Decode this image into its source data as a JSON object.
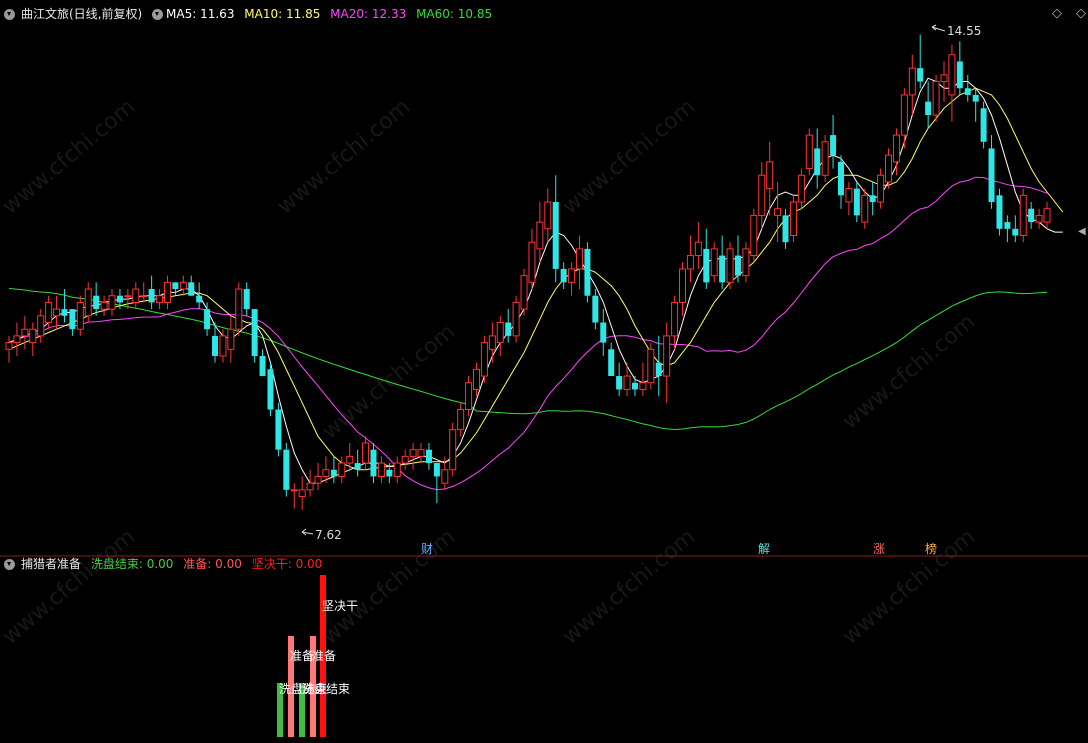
{
  "main": {
    "title": "曲江文旅(日线,前复权)",
    "ma_legend": [
      {
        "label": "MA5:",
        "value": "11.63",
        "color": "#ffffff"
      },
      {
        "label": "MA10:",
        "value": "11.85",
        "color": "#ffff66"
      },
      {
        "label": "MA20:",
        "value": "12.33",
        "color": "#ff44ff"
      },
      {
        "label": "MA60:",
        "value": "10.85",
        "color": "#33dd33"
      }
    ],
    "high_label": "14.55",
    "low_label": "7.62",
    "event_markers": [
      {
        "label": "财",
        "color": "#66aaff"
      },
      {
        "label": "解",
        "color": "#66dddd"
      },
      {
        "label": "涨",
        "color": "#ff6666"
      },
      {
        "label": "榜",
        "color": "#ffaa44"
      }
    ],
    "watermark": "www.cfchi.com"
  },
  "sub": {
    "title": "捕猎者准备",
    "legend": [
      {
        "label": "洗盘结束:",
        "value": "0.00",
        "color": "#44cc44"
      },
      {
        "label": "准备:",
        "value": "0.00",
        "color": "#ff5555"
      },
      {
        "label": "坚决干:",
        "value": "0.00",
        "color": "#ff2222"
      }
    ],
    "bar_labels": {
      "wash": "洗盘结束",
      "ready": "准备",
      "decisive": "坚决干"
    }
  },
  "colors": {
    "up": "#ff3333",
    "down": "#2ee6e6",
    "bg": "#000000",
    "divider": "#8a1a1a"
  },
  "chart_data": {
    "type": "candlestick",
    "ylim": [
      7.3,
      14.8
    ],
    "candles": [
      [
        10.0,
        10.2,
        9.8,
        10.1
      ],
      [
        10.1,
        10.4,
        9.9,
        10.2
      ],
      [
        10.2,
        10.5,
        10.0,
        10.3
      ],
      [
        10.1,
        10.4,
        9.9,
        10.3
      ],
      [
        10.2,
        10.6,
        10.1,
        10.5
      ],
      [
        10.4,
        10.8,
        10.3,
        10.7
      ],
      [
        10.5,
        10.8,
        10.3,
        10.6
      ],
      [
        10.6,
        10.9,
        10.4,
        10.5
      ],
      [
        10.6,
        10.6,
        10.2,
        10.3
      ],
      [
        10.3,
        10.8,
        10.2,
        10.7
      ],
      [
        10.5,
        11.0,
        10.4,
        10.9
      ],
      [
        10.8,
        11.0,
        10.5,
        10.6
      ],
      [
        10.6,
        10.8,
        10.5,
        10.7
      ],
      [
        10.6,
        10.9,
        10.5,
        10.8
      ],
      [
        10.8,
        10.9,
        10.6,
        10.7
      ],
      [
        10.8,
        10.9,
        10.6,
        10.8
      ],
      [
        10.7,
        11.0,
        10.6,
        10.9
      ],
      [
        10.8,
        11.0,
        10.7,
        10.8
      ],
      [
        10.9,
        11.1,
        10.6,
        10.7
      ],
      [
        10.7,
        10.9,
        10.6,
        10.8
      ],
      [
        10.7,
        11.1,
        10.6,
        11.0
      ],
      [
        11.0,
        11.0,
        10.8,
        10.9
      ],
      [
        10.9,
        11.1,
        10.8,
        11.0
      ],
      [
        11.0,
        11.1,
        10.8,
        10.8
      ],
      [
        10.8,
        11.0,
        10.6,
        10.7
      ],
      [
        10.6,
        10.7,
        10.2,
        10.3
      ],
      [
        10.2,
        10.4,
        9.8,
        9.9
      ],
      [
        9.9,
        10.3,
        9.8,
        10.2
      ],
      [
        10.0,
        10.5,
        9.8,
        10.3
      ],
      [
        10.3,
        11.0,
        10.2,
        10.9
      ],
      [
        10.9,
        11.0,
        10.5,
        10.6
      ],
      [
        10.6,
        10.6,
        9.8,
        9.9
      ],
      [
        9.9,
        10.0,
        9.6,
        9.6
      ],
      [
        9.7,
        9.8,
        9.0,
        9.1
      ],
      [
        9.1,
        9.2,
        8.4,
        8.5
      ],
      [
        8.5,
        8.6,
        7.8,
        7.9
      ],
      [
        7.9,
        8.0,
        7.62,
        7.9
      ],
      [
        7.8,
        8.1,
        7.6,
        7.9
      ],
      [
        7.9,
        8.2,
        7.8,
        8.0
      ],
      [
        8.0,
        8.3,
        7.9,
        8.1
      ],
      [
        8.1,
        8.4,
        8.0,
        8.2
      ],
      [
        8.2,
        8.4,
        8.0,
        8.1
      ],
      [
        8.1,
        8.4,
        8.0,
        8.3
      ],
      [
        8.3,
        8.6,
        8.2,
        8.4
      ],
      [
        8.3,
        8.5,
        8.1,
        8.2
      ],
      [
        8.3,
        8.7,
        8.2,
        8.6
      ],
      [
        8.5,
        8.6,
        8.0,
        8.1
      ],
      [
        8.1,
        8.4,
        8.0,
        8.3
      ],
      [
        8.2,
        8.3,
        8.0,
        8.1
      ],
      [
        8.1,
        8.4,
        8.0,
        8.3
      ],
      [
        8.3,
        8.5,
        8.2,
        8.4
      ],
      [
        8.4,
        8.6,
        8.2,
        8.5
      ],
      [
        8.4,
        8.6,
        8.3,
        8.5
      ],
      [
        8.5,
        8.6,
        8.2,
        8.3
      ],
      [
        8.3,
        8.3,
        7.7,
        8.1
      ],
      [
        8.0,
        8.4,
        7.9,
        8.2
      ],
      [
        8.2,
        8.9,
        8.1,
        8.8
      ],
      [
        8.8,
        9.2,
        8.7,
        9.1
      ],
      [
        9.1,
        9.6,
        9.0,
        9.5
      ],
      [
        9.4,
        9.8,
        9.3,
        9.7
      ],
      [
        9.6,
        10.2,
        9.5,
        10.1
      ],
      [
        10.0,
        10.4,
        9.8,
        10.2
      ],
      [
        10.1,
        10.5,
        9.9,
        10.4
      ],
      [
        10.4,
        10.6,
        10.1,
        10.2
      ],
      [
        10.2,
        10.8,
        10.1,
        10.7
      ],
      [
        10.6,
        11.2,
        10.5,
        11.1
      ],
      [
        11.0,
        11.8,
        10.9,
        11.6
      ],
      [
        11.5,
        12.2,
        11.3,
        11.9
      ],
      [
        11.8,
        12.4,
        11.6,
        12.2
      ],
      [
        12.2,
        12.6,
        11.0,
        11.2
      ],
      [
        11.2,
        11.3,
        10.9,
        11.0
      ],
      [
        11.0,
        11.3,
        10.8,
        11.2
      ],
      [
        11.2,
        11.7,
        10.9,
        11.5
      ],
      [
        11.5,
        11.6,
        10.7,
        10.8
      ],
      [
        10.8,
        10.9,
        10.3,
        10.4
      ],
      [
        10.4,
        10.6,
        9.9,
        10.1
      ],
      [
        10.0,
        10.1,
        9.6,
        9.6
      ],
      [
        9.6,
        9.8,
        9.3,
        9.4
      ],
      [
        9.4,
        9.8,
        9.3,
        9.6
      ],
      [
        9.5,
        9.6,
        9.3,
        9.4
      ],
      [
        9.4,
        9.8,
        9.3,
        9.5
      ],
      [
        9.5,
        10.1,
        9.4,
        10.0
      ],
      [
        9.8,
        10.2,
        9.3,
        9.6
      ],
      [
        9.6,
        10.4,
        9.2,
        10.2
      ],
      [
        10.2,
        10.8,
        10.0,
        10.7
      ],
      [
        10.7,
        11.3,
        10.5,
        11.2
      ],
      [
        11.2,
        11.7,
        11.0,
        11.4
      ],
      [
        11.4,
        11.9,
        11.2,
        11.6
      ],
      [
        11.5,
        11.8,
        10.9,
        11.0
      ],
      [
        11.1,
        11.6,
        11.0,
        11.5
      ],
      [
        11.4,
        11.7,
        10.9,
        11.0
      ],
      [
        11.0,
        11.6,
        10.9,
        11.5
      ],
      [
        11.4,
        11.7,
        11.0,
        11.1
      ],
      [
        11.1,
        11.6,
        11.0,
        11.5
      ],
      [
        11.4,
        12.1,
        11.3,
        12.0
      ],
      [
        12.0,
        12.8,
        11.8,
        12.6
      ],
      [
        12.4,
        13.1,
        12.0,
        12.8
      ],
      [
        12.0,
        12.5,
        11.6,
        12.1
      ],
      [
        12.0,
        12.1,
        11.5,
        11.6
      ],
      [
        11.7,
        12.3,
        11.6,
        12.2
      ],
      [
        12.2,
        12.7,
        12.1,
        12.6
      ],
      [
        12.7,
        13.3,
        12.6,
        13.2
      ],
      [
        13.0,
        13.3,
        12.4,
        12.6
      ],
      [
        12.6,
        13.2,
        12.5,
        13.1
      ],
      [
        13.2,
        13.5,
        12.7,
        12.9
      ],
      [
        12.8,
        12.9,
        12.1,
        12.3
      ],
      [
        12.2,
        12.5,
        12.0,
        12.4
      ],
      [
        12.4,
        12.5,
        11.9,
        12.0
      ],
      [
        11.9,
        12.4,
        11.8,
        12.3
      ],
      [
        12.3,
        12.5,
        12.0,
        12.2
      ],
      [
        12.2,
        12.7,
        12.1,
        12.6
      ],
      [
        12.5,
        13.0,
        12.4,
        12.9
      ],
      [
        12.8,
        13.3,
        12.6,
        13.2
      ],
      [
        13.2,
        13.9,
        13.0,
        13.8
      ],
      [
        13.8,
        14.4,
        13.5,
        14.2
      ],
      [
        14.2,
        14.7,
        13.9,
        14.0
      ],
      [
        13.7,
        14.0,
        13.3,
        13.5
      ],
      [
        13.5,
        14.1,
        13.4,
        14.0
      ],
      [
        14.0,
        14.3,
        13.7,
        14.1
      ],
      [
        13.8,
        14.55,
        13.4,
        14.4
      ],
      [
        14.3,
        14.6,
        13.8,
        13.9
      ],
      [
        13.9,
        14.1,
        13.7,
        13.8
      ],
      [
        13.8,
        13.9,
        13.4,
        13.7
      ],
      [
        13.6,
        13.7,
        13.0,
        13.1
      ],
      [
        13.0,
        13.2,
        12.1,
        12.2
      ],
      [
        12.3,
        12.4,
        11.7,
        11.8
      ],
      [
        11.9,
        12.0,
        11.6,
        11.8
      ],
      [
        11.8,
        12.0,
        11.6,
        11.7
      ],
      [
        11.7,
        12.4,
        11.6,
        12.3
      ],
      [
        12.1,
        12.2,
        11.8,
        11.9
      ],
      [
        11.9,
        12.1,
        11.8,
        12.0
      ],
      [
        11.9,
        12.2,
        11.8,
        12.1
      ]
    ],
    "ma5": [
      10.1,
      10.15,
      10.2,
      10.25,
      10.3,
      10.4,
      10.5,
      10.55,
      10.55,
      10.6,
      10.65,
      10.65,
      10.7,
      10.72,
      10.75,
      10.75,
      10.78,
      10.8,
      10.8,
      10.8,
      10.85,
      10.85,
      10.9,
      10.9,
      10.8,
      10.6,
      10.35,
      10.2,
      10.15,
      10.25,
      10.35,
      10.4,
      10.2,
      9.8,
      9.3,
      8.85,
      8.45,
      8.2,
      8.0,
      8.0,
      8.05,
      8.1,
      8.15,
      8.2,
      8.25,
      8.3,
      8.3,
      8.3,
      8.25,
      8.25,
      8.3,
      8.35,
      8.4,
      8.4,
      8.35,
      8.3,
      8.4,
      8.6,
      8.9,
      9.25,
      9.6,
      9.9,
      10.1,
      10.25,
      10.4,
      10.6,
      10.9,
      11.3,
      11.6,
      11.75,
      11.7,
      11.55,
      11.35,
      11.15,
      10.95,
      10.7,
      10.35,
      10.0,
      9.75,
      9.55,
      9.5,
      9.55,
      9.6,
      9.75,
      10.0,
      10.4,
      10.8,
      11.1,
      11.3,
      11.35,
      11.35,
      11.35,
      11.35,
      11.4,
      11.5,
      11.8,
      12.1,
      12.3,
      12.35,
      12.3,
      12.3,
      12.5,
      12.7,
      12.85,
      12.9,
      12.85,
      12.7,
      12.5,
      12.35,
      12.25,
      12.3,
      12.5,
      12.75,
      13.1,
      13.5,
      13.85,
      14.05,
      14.0,
      13.9,
      13.9,
      14.0,
      14.0,
      13.9,
      13.75,
      13.5,
      13.15,
      12.75,
      12.35,
      12.05,
      11.95,
      11.9,
      11.8,
      11.75,
      11.75
    ],
    "ma10": [
      10.0,
      10.05,
      10.1,
      10.15,
      10.2,
      10.25,
      10.3,
      10.35,
      10.4,
      10.45,
      10.5,
      10.55,
      10.58,
      10.62,
      10.65,
      10.68,
      10.7,
      10.72,
      10.74,
      10.76,
      10.78,
      10.8,
      10.82,
      10.84,
      10.84,
      10.8,
      10.7,
      10.6,
      10.5,
      10.45,
      10.4,
      10.38,
      10.3,
      10.15,
      9.95,
      9.7,
      9.45,
      9.2,
      8.95,
      8.7,
      8.55,
      8.4,
      8.3,
      8.25,
      8.2,
      8.2,
      8.22,
      8.24,
      8.25,
      8.27,
      8.28,
      8.3,
      8.32,
      8.32,
      8.32,
      8.32,
      8.35,
      8.45,
      8.6,
      8.75,
      8.95,
      9.15,
      9.35,
      9.55,
      9.75,
      9.95,
      10.2,
      10.45,
      10.7,
      10.9,
      11.05,
      11.15,
      11.2,
      11.2,
      11.15,
      11.05,
      10.95,
      10.8,
      10.6,
      10.35,
      10.15,
      9.95,
      9.8,
      9.75,
      9.8,
      9.95,
      10.1,
      10.3,
      10.5,
      10.7,
      10.85,
      11.0,
      11.1,
      11.2,
      11.3,
      11.45,
      11.6,
      11.8,
      11.95,
      12.05,
      12.1,
      12.2,
      12.3,
      12.45,
      12.55,
      12.6,
      12.6,
      12.6,
      12.55,
      12.5,
      12.45,
      12.45,
      12.5,
      12.65,
      12.85,
      13.1,
      13.3,
      13.45,
      13.6,
      13.7,
      13.8,
      13.85,
      13.9,
      13.85,
      13.8,
      13.65,
      13.45,
      13.2,
      12.95,
      12.7,
      12.5,
      12.35,
      12.2,
      12.05
    ]
  }
}
